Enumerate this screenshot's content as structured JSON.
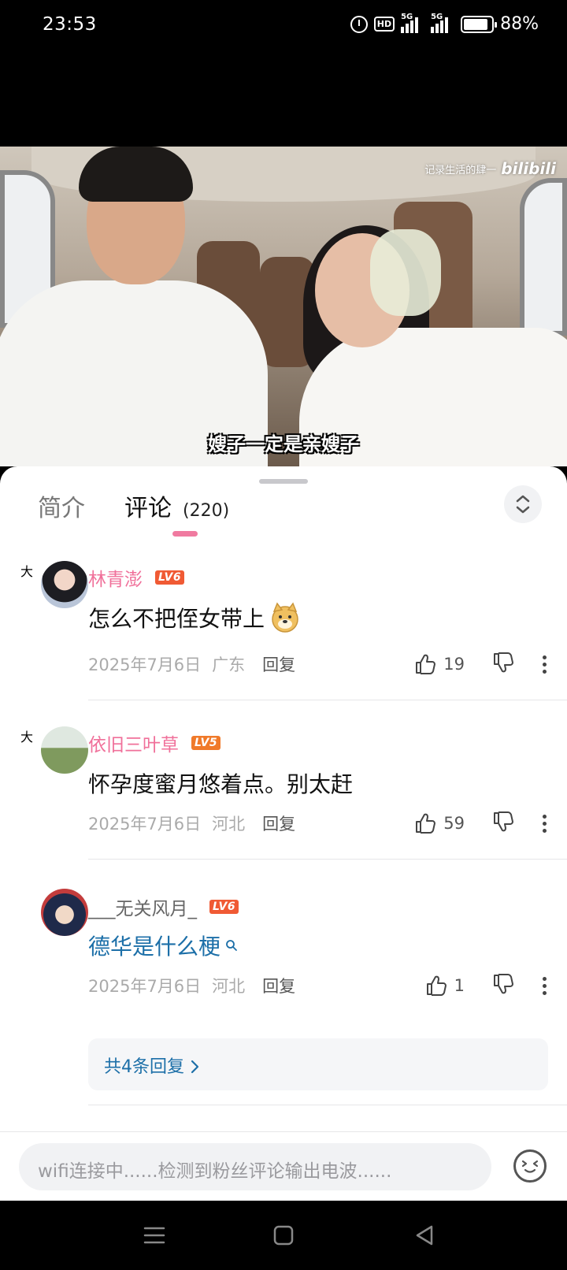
{
  "status_bar": {
    "time": "23:53",
    "battery": "88%",
    "battery_level": 0.88,
    "icons": [
      "alarm-icon",
      "hd-icon",
      "5g-signal-icon",
      "5g-signal-icon",
      "battery-icon"
    ],
    "hd_label": "HD",
    "net1": "5G",
    "net2": "5G"
  },
  "video": {
    "watermark_text": "记录生活的肆一",
    "watermark_logo": "bilibili",
    "subtitle": "嫂子一定是亲嫂子"
  },
  "tabs": {
    "intro": "简介",
    "comments": "评论",
    "comment_count": "(220)"
  },
  "comments": [
    {
      "username": "林青澎",
      "level": "LV6",
      "level_color": "#f05a34",
      "badge": "大",
      "text": "怎么不把侄女带上",
      "has_emoji": true,
      "date": "2025年7月6日",
      "location": "广东",
      "reply_label": "回复",
      "likes": "19"
    },
    {
      "username": "依旧三叶草",
      "level": "LV5",
      "level_color": "#f07a2a",
      "badge": "大",
      "text": "怀孕度蜜月悠着点。别太赶",
      "date": "2025年7月6日",
      "location": "河北",
      "reply_label": "回复",
      "likes": "59"
    },
    {
      "username": "___无关风月_",
      "level": "LV6",
      "level_color": "#f05a34",
      "text": "德华是什么梗",
      "text_is_search_link": true,
      "date": "2025年7月6日",
      "location": "河北",
      "reply_label": "回复",
      "likes": "1",
      "replies_summary": "共4条回复"
    }
  ],
  "input": {
    "placeholder": "wifi连接中......检测到粉丝评论输出电波......"
  },
  "colors": {
    "accent_pink": "#f07aa0",
    "link_blue": "#1c6fa8"
  }
}
